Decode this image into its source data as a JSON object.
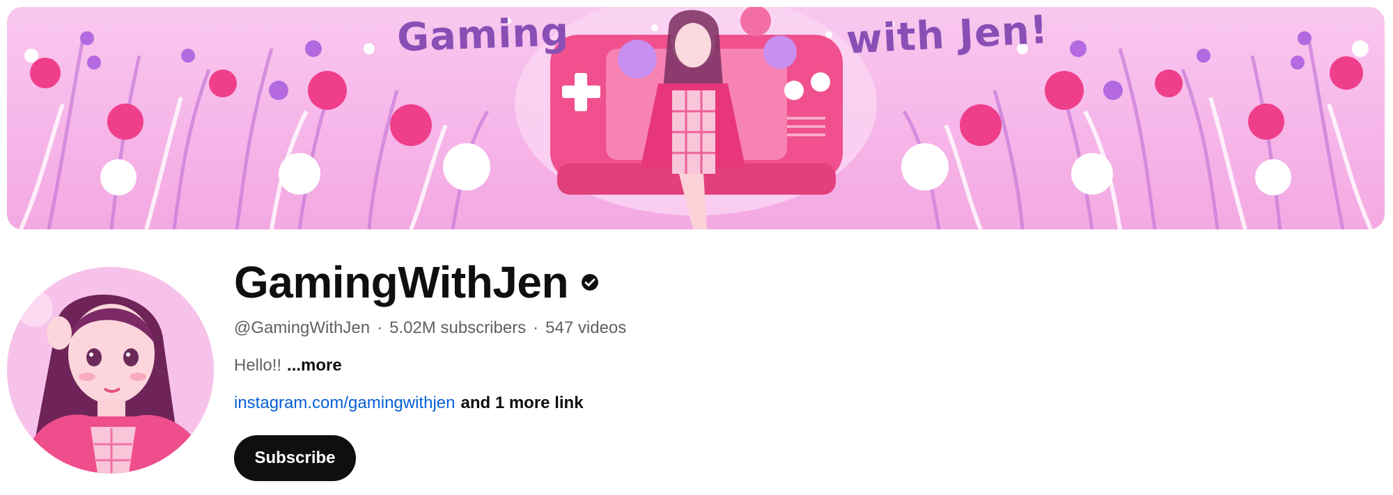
{
  "banner": {
    "text_left": "Gaming",
    "text_right": "with Jen!"
  },
  "channel": {
    "name": "GamingWithJen",
    "handle": "@GamingWithJen",
    "separator": "·",
    "subscribers": "5.02M subscribers",
    "videos": "547 videos",
    "description": "Hello!!",
    "description_more": "...more",
    "link_main": "instagram.com/gamingwithjen",
    "link_more": "and 1 more link",
    "verified_icon": "verified-check-icon"
  },
  "actions": {
    "subscribe_label": "Subscribe"
  },
  "colors": {
    "banner_pink": "#f6b6e9",
    "link_blue": "#065fd4",
    "meta_gray": "#606060",
    "subscribe_bg": "#0f0f0f"
  }
}
